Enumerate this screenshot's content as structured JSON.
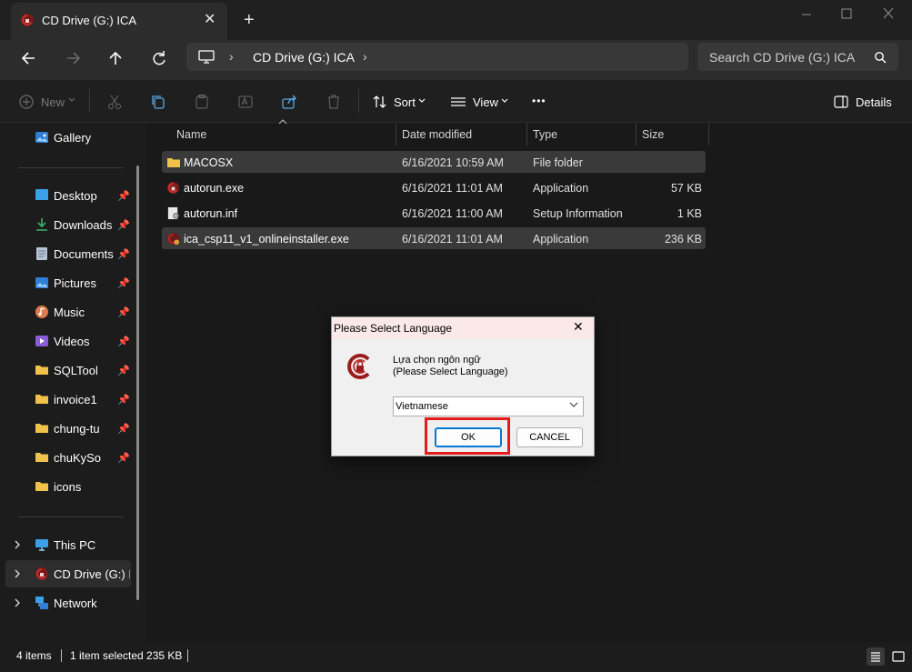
{
  "window": {
    "tab_title": "CD Drive (G:) ICA",
    "tab_close": "✕",
    "new_tab": "+"
  },
  "address": {
    "chevron": "›",
    "path": "CD Drive (G:) ICA",
    "search_placeholder": "Search CD Drive (G:) ICA"
  },
  "toolbar": {
    "new_label": "New",
    "sort_label": "Sort",
    "view_label": "View",
    "more_label": "•••",
    "details_label": "Details"
  },
  "nav": {
    "gallery": "Gallery",
    "pin": "📌",
    "quick": [
      {
        "label": "Desktop"
      },
      {
        "label": "Downloads"
      },
      {
        "label": "Documents"
      },
      {
        "label": "Pictures"
      },
      {
        "label": "Music"
      },
      {
        "label": "Videos"
      },
      {
        "label": "SQLTool"
      },
      {
        "label": "invoice1"
      },
      {
        "label": "chung-tu"
      },
      {
        "label": "chuKySo"
      },
      {
        "label": "icons"
      }
    ],
    "this_pc": "This PC",
    "cd_drive": "CD Drive (G:) ICA",
    "network": "Network"
  },
  "columns": {
    "name": "Name",
    "date": "Date modified",
    "type": "Type",
    "size": "Size"
  },
  "files": [
    {
      "name": "MACOSX",
      "date": "6/16/2021 10:59 AM",
      "type": "File folder",
      "size": ""
    },
    {
      "name": "autorun.exe",
      "date": "6/16/2021 11:01 AM",
      "type": "Application",
      "size": "57 KB"
    },
    {
      "name": "autorun.inf",
      "date": "6/16/2021 11:00 AM",
      "type": "Setup Information",
      "size": "1 KB"
    },
    {
      "name": "ica_csp11_v1_onlineinstaller.exe",
      "date": "6/16/2021 11:01 AM",
      "type": "Application",
      "size": "236 KB"
    }
  ],
  "status": {
    "items": "4 items",
    "selected": "1 item selected  235 KB"
  },
  "dialog": {
    "title": "Please Select Language",
    "close": "✕",
    "message_line1": "Lựa chọn ngôn ngữ",
    "message_line2": "(Please Select Language)",
    "selected_language": "Vietnamese",
    "ok_label": "OK",
    "cancel_label": "CANCEL"
  },
  "colors": {
    "accent_red": "#e31b1b",
    "ica_logo": "#9b1c1c",
    "folder_yellow": "#f0c24b"
  }
}
